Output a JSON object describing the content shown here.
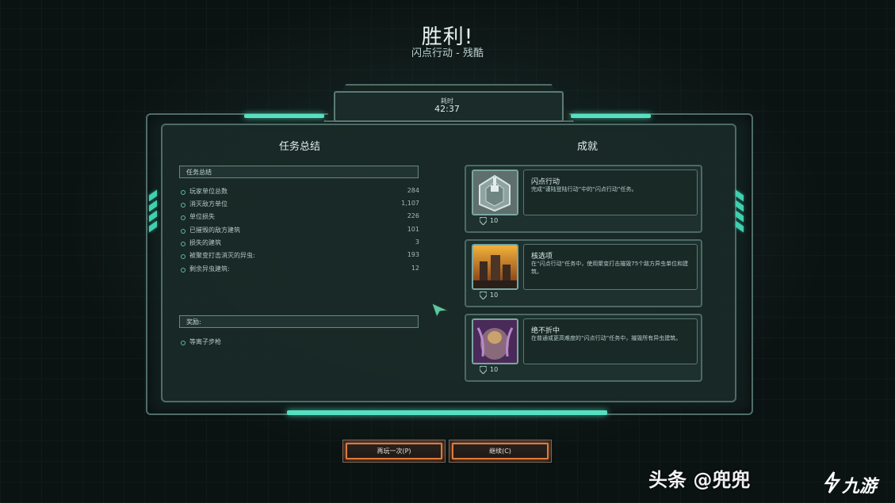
{
  "header": {
    "title": "胜利!",
    "subtitle": "闪点行动 - 残酷"
  },
  "timer": {
    "label": "耗时",
    "value": "42:37"
  },
  "mission_summary": {
    "title": "任务总结",
    "section_label": "任务总结",
    "stats": [
      {
        "label": "玩家单位总数",
        "value": "284"
      },
      {
        "label": "消灭敌方单位",
        "value": "1,107"
      },
      {
        "label": "单位损失",
        "value": "226"
      },
      {
        "label": "已摧毁的敌方建筑",
        "value": "101"
      },
      {
        "label": "损失的建筑",
        "value": "3"
      },
      {
        "label": "被聚变打击消灭的异虫:",
        "value": "193"
      },
      {
        "label": "剩余异虫建筑:",
        "value": "12"
      }
    ],
    "rewards_label": "奖励:",
    "rewards": [
      {
        "label": "等离子步枪"
      }
    ]
  },
  "achievements": {
    "title": "成就",
    "items": [
      {
        "name": "闪点行动",
        "description": "完成“谨陆登陆行动”中的“闪点行动”任务。",
        "points": "10",
        "icon": "shield-emblem-icon"
      },
      {
        "name": "核选项",
        "description": "在“闪点行动”任务中，使用聚变打击摧毁75个敌方异虫单位和建筑。",
        "points": "10",
        "icon": "burning-base-icon"
      },
      {
        "name": "绝不折中",
        "description": "在普通或更高难度的“闪点行动”任务中，摧毁所有异虫建筑。",
        "points": "10",
        "icon": "zerg-creature-icon"
      }
    ]
  },
  "buttons": {
    "replay": "再玩一次(P)",
    "continue": "继续(C)"
  },
  "watermark": {
    "left": "头条 @兜兜",
    "right": "九游"
  },
  "colors": {
    "accent_glow": "#56e0c1",
    "button_border": "#e0783a"
  }
}
